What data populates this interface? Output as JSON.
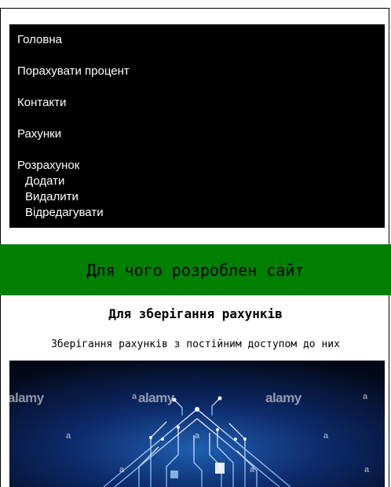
{
  "nav": {
    "items": [
      {
        "label": "Головна"
      },
      {
        "label": "Порахувати процент"
      },
      {
        "label": "Контакти"
      },
      {
        "label": "Рахунки"
      },
      {
        "label": "Розрахунок"
      }
    ],
    "subitems": [
      {
        "label": "Додати"
      },
      {
        "label": "Видалити"
      },
      {
        "label": "Відредагувати"
      }
    ]
  },
  "banner": {
    "title": "Для чого розроблен сайт"
  },
  "section": {
    "title": "Для зберігання рахунків",
    "text": "Зберігання рахунків з постійним доступом до них"
  },
  "illustration": {
    "watermark": "alamy",
    "watermark_small": "a"
  },
  "colors": {
    "nav_bg": "#000000",
    "banner_bg": "#008000",
    "illustration_bg": "#0a1a4a"
  }
}
